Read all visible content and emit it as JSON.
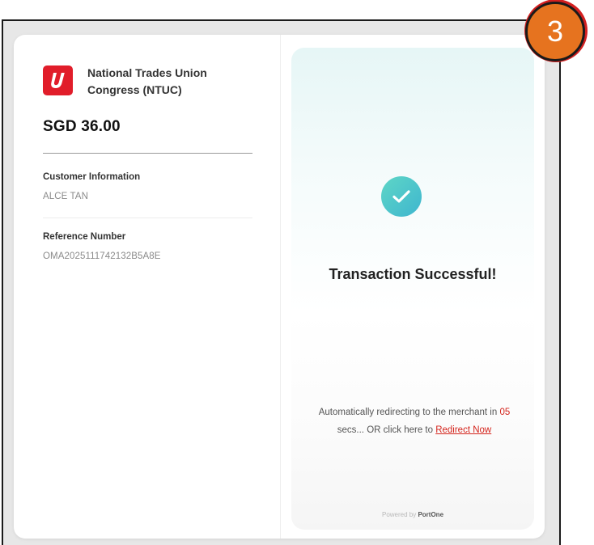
{
  "merchant": {
    "name": "National Trades Union\nCongress (NTUC)",
    "brand_color": "#e11d2a"
  },
  "payment": {
    "amount": "SGD 36.00"
  },
  "customer": {
    "label": "Customer Information",
    "value": "ALCE TAN"
  },
  "reference": {
    "label": "Reference Number",
    "value": "OMA2025111742132B5A8E"
  },
  "status": {
    "icon": "check-icon",
    "title": "Transaction Successful!",
    "accent_color": "#3fb6cf"
  },
  "redirect": {
    "prefix": "Automatically redirecting to the merchant in ",
    "seconds": "05",
    "middle": "secs... OR click here to ",
    "link_label": "Redirect Now",
    "link_color": "#d4241c"
  },
  "footer": {
    "powered_prefix": "Powered by ",
    "powered_brand": "PortOne"
  },
  "step_badge": {
    "number": "3",
    "color": "#e6731f"
  }
}
